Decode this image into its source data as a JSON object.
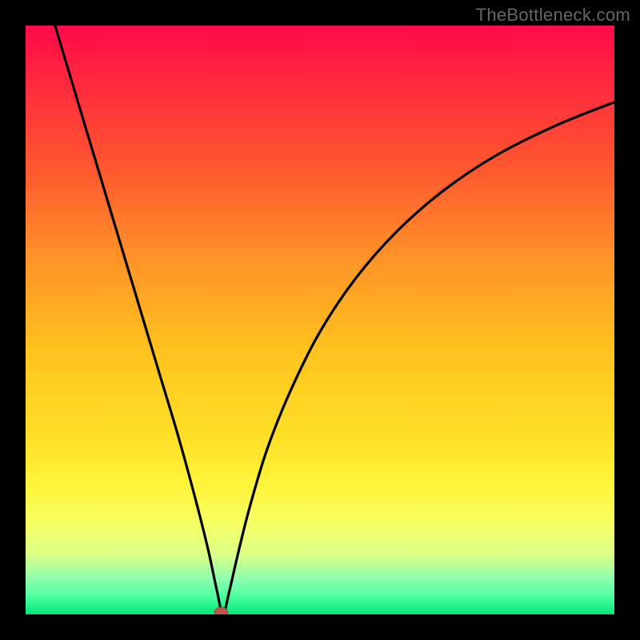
{
  "watermark": "TheBottleneck.com",
  "colors": {
    "frame": "#000000",
    "gradient_stops": [
      {
        "offset": 0.0,
        "color": "#ff0a4a"
      },
      {
        "offset": 0.1,
        "color": "#ff2a3e"
      },
      {
        "offset": 0.25,
        "color": "#ff5a2e"
      },
      {
        "offset": 0.4,
        "color": "#ff9428"
      },
      {
        "offset": 0.55,
        "color": "#ffc21e"
      },
      {
        "offset": 0.7,
        "color": "#ffe028"
      },
      {
        "offset": 0.78,
        "color": "#fff43a"
      },
      {
        "offset": 0.85,
        "color": "#f6ff66"
      },
      {
        "offset": 0.9,
        "color": "#d8ff88"
      },
      {
        "offset": 0.94,
        "color": "#8cffae"
      },
      {
        "offset": 0.97,
        "color": "#4CFF9F"
      },
      {
        "offset": 1.0,
        "color": "#00e878"
      }
    ],
    "curve": "#000000",
    "marker_fill": "#c0564a",
    "marker_stroke": "#a04038"
  },
  "chart_data": {
    "type": "line",
    "title": "",
    "xlabel": "",
    "ylabel": "",
    "xlim": [
      0,
      100
    ],
    "ylim": [
      0,
      100
    ],
    "curve": {
      "minimum_x": 33.5,
      "minimum_y": 0,
      "points": [
        {
          "x": 5.0,
          "y": 100.0
        },
        {
          "x": 8.0,
          "y": 90.0
        },
        {
          "x": 11.0,
          "y": 80.0
        },
        {
          "x": 14.0,
          "y": 70.0
        },
        {
          "x": 17.0,
          "y": 60.0
        },
        {
          "x": 20.0,
          "y": 50.0
        },
        {
          "x": 23.0,
          "y": 40.0
        },
        {
          "x": 26.0,
          "y": 30.0
        },
        {
          "x": 29.0,
          "y": 19.0
        },
        {
          "x": 31.0,
          "y": 11.0
        },
        {
          "x": 32.5,
          "y": 4.0
        },
        {
          "x": 33.5,
          "y": 0.0
        },
        {
          "x": 34.5,
          "y": 3.5
        },
        {
          "x": 36.0,
          "y": 10.0
        },
        {
          "x": 38.0,
          "y": 18.0
        },
        {
          "x": 41.0,
          "y": 28.0
        },
        {
          "x": 45.0,
          "y": 38.0
        },
        {
          "x": 50.0,
          "y": 48.0
        },
        {
          "x": 56.0,
          "y": 57.0
        },
        {
          "x": 63.0,
          "y": 65.0
        },
        {
          "x": 71.0,
          "y": 72.0
        },
        {
          "x": 80.0,
          "y": 78.0
        },
        {
          "x": 90.0,
          "y": 83.0
        },
        {
          "x": 100.0,
          "y": 87.0
        }
      ]
    },
    "marker": {
      "x": 33.2,
      "y": 0.4,
      "rx": 1.1,
      "ry": 0.8
    }
  }
}
